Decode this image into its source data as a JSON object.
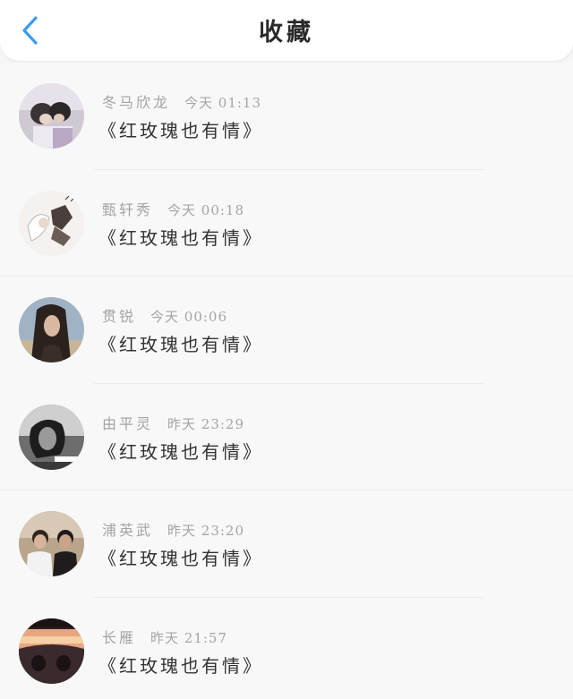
{
  "header": {
    "title": "收藏",
    "back_icon": "chevron-left-icon",
    "accent_color": "#3a9bea"
  },
  "favorites": [
    {
      "name": "冬马欣龙",
      "time": "今天 01:13",
      "title": "《红玫瑰也有情》",
      "avatar": "avatar-couple-photo"
    },
    {
      "name": "甄轩秀",
      "time": "今天 00:18",
      "title": "《红玫瑰也有情》",
      "avatar": "avatar-illustration"
    },
    {
      "name": "贯锐",
      "time": "今天 00:06",
      "title": "《红玫瑰也有情》",
      "avatar": "avatar-girl-photo"
    },
    {
      "name": "由平灵",
      "time": "昨天 23:29",
      "title": "《红玫瑰也有情》",
      "avatar": "avatar-monochrome-photo"
    },
    {
      "name": "浦英武",
      "time": "昨天 23:20",
      "title": "《红玫瑰也有情》",
      "avatar": "avatar-two-boys-photo"
    },
    {
      "name": "长雁",
      "time": "昨天 21:57",
      "title": "《红玫瑰也有情》",
      "avatar": "avatar-car-sunset-photo"
    }
  ]
}
